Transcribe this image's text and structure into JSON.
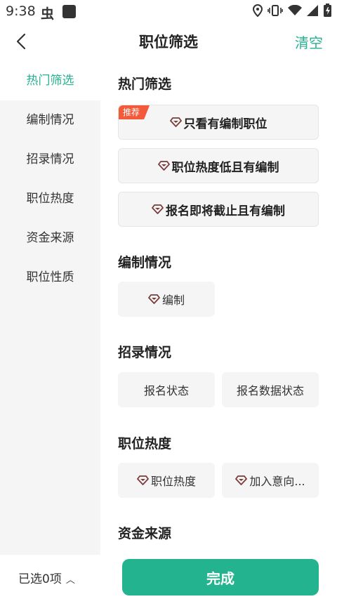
{
  "status_bar": {
    "time": "9:38",
    "left_glyph": "虫"
  },
  "header": {
    "title": "职位筛选",
    "clear_label": "清空"
  },
  "sidebar": {
    "items": [
      {
        "label": "热门筛选",
        "active": true
      },
      {
        "label": "编制情况",
        "active": false
      },
      {
        "label": "招录情况",
        "active": false
      },
      {
        "label": "职位热度",
        "active": false
      },
      {
        "label": "资金来源",
        "active": false
      },
      {
        "label": "职位性质",
        "active": false
      }
    ]
  },
  "content": {
    "hot": {
      "title": "热门筛选",
      "badge": "推荐",
      "options": [
        "只看有编制职位",
        "职位热度低且有编制",
        "报名即将截止且有编制"
      ]
    },
    "staffing": {
      "title": "编制情况",
      "options": [
        "编制"
      ]
    },
    "recruit": {
      "title": "招录情况",
      "options": [
        "报名状态",
        "报名数据状态"
      ]
    },
    "heat": {
      "title": "职位热度",
      "options": [
        "职位热度",
        "加入意向..."
      ]
    },
    "funding": {
      "title": "资金来源"
    }
  },
  "bottom": {
    "selected_label": "已选0项",
    "done_label": "完成"
  },
  "colors": {
    "accent": "#27b290",
    "done_button": "#23b38f",
    "badge": "#f25a3a",
    "vip_icon": "#7b3b3b"
  },
  "icons": [
    "back-arrow-icon",
    "vip-diamond-icon",
    "location-icon",
    "vibrate-icon",
    "wifi-icon",
    "signal-icon",
    "battery-icon",
    "chevron-up-icon"
  ]
}
